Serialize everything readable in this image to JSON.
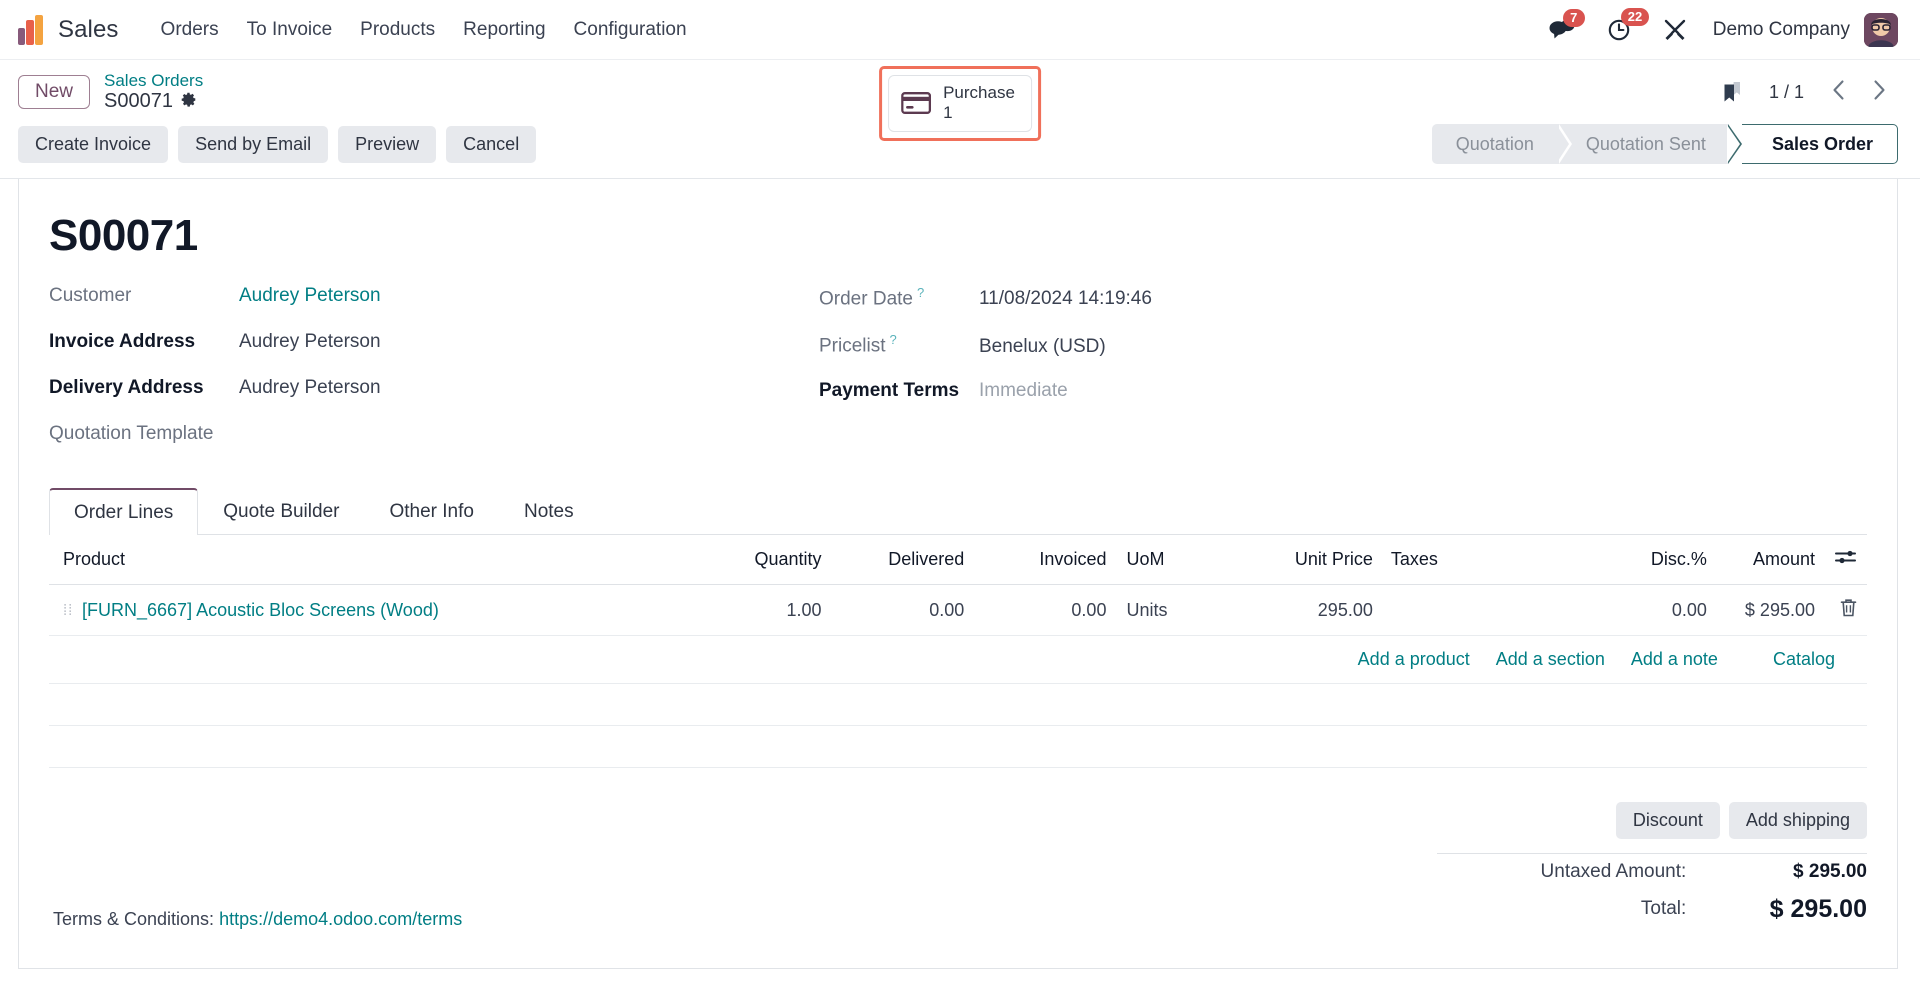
{
  "navbar": {
    "brand": "Sales",
    "menu": [
      "Orders",
      "To Invoice",
      "Products",
      "Reporting",
      "Configuration"
    ],
    "messages_icon": "chat-bubbles-icon",
    "messages_count": "7",
    "activities_icon": "clock-icon",
    "activities_count": "22",
    "debug_icon": "tools-icon",
    "company": "Demo Company",
    "avatar_icon": "user-avatar-icon"
  },
  "control_panel": {
    "new_button": "New",
    "breadcrumb_parent": "Sales Orders",
    "breadcrumb_current": "S00071",
    "settings_icon": "gear-icon",
    "stat_button": {
      "icon": "credit-card-icon",
      "label": "Purchase",
      "value": "1",
      "highlight_color": "#f0705a"
    },
    "bookmark_icon": "bookmark-icon",
    "pager": "1 / 1",
    "prev_icon": "chevron-left-icon",
    "next_icon": "chevron-right-icon",
    "actions": [
      "Create Invoice",
      "Send by Email",
      "Preview",
      "Cancel"
    ],
    "statusbar": {
      "stages": [
        "Quotation",
        "Quotation Sent",
        "Sales Order"
      ],
      "active": "Sales Order",
      "active_border_color": "#3d6b6e"
    }
  },
  "record": {
    "title": "S00071",
    "left_fields": [
      {
        "label": "Customer",
        "value": "Audrey Peterson",
        "label_style": "muted",
        "value_style": "link"
      },
      {
        "label": "Invoice Address",
        "value": "Audrey Peterson",
        "label_style": "bold",
        "value_style": "text"
      },
      {
        "label": "Delivery Address",
        "value": "Audrey Peterson",
        "label_style": "bold",
        "value_style": "text"
      },
      {
        "label": "Quotation Template",
        "value": "",
        "label_style": "muted",
        "value_style": "text"
      }
    ],
    "right_fields": [
      {
        "label": "Order Date",
        "help": "?",
        "value": "11/08/2024 14:19:46",
        "label_style": "muted",
        "value_style": "text"
      },
      {
        "label": "Pricelist",
        "help": "?",
        "value": "Benelux (USD)",
        "label_style": "muted",
        "value_style": "text"
      },
      {
        "label": "Payment Terms",
        "help": "",
        "value": "Immediate",
        "label_style": "bold",
        "value_style": "placeholder"
      }
    ]
  },
  "notebook": {
    "tabs": [
      "Order Lines",
      "Quote Builder",
      "Other Info",
      "Notes"
    ],
    "active_tab": "Order Lines",
    "options_icon": "column-options-icon",
    "columns": [
      "Product",
      "Quantity",
      "Delivered",
      "Invoiced",
      "UoM",
      "Unit Price",
      "Taxes",
      "Disc.%",
      "Amount"
    ],
    "rows": [
      {
        "drag_icon": "drag-handle-icon",
        "product": "[FURN_6667] Acoustic Bloc Screens (Wood)",
        "quantity": "1.00",
        "delivered": "0.00",
        "invoiced": "0.00",
        "uom": "Units",
        "unit_price": "295.00",
        "taxes": "",
        "discount": "0.00",
        "amount": "$ 295.00",
        "delete_icon": "trash-icon"
      }
    ],
    "add_links": [
      "Add a product",
      "Add a section",
      "Add a note",
      "Catalog"
    ]
  },
  "footer": {
    "terms_label": "Terms & Conditions:",
    "terms_url": "https://demo4.odoo.com/terms",
    "buttons": [
      "Discount",
      "Add shipping"
    ],
    "totals": [
      {
        "label": "Untaxed Amount:",
        "value": "$ 295.00"
      },
      {
        "label": "Total:",
        "value": "$ 295.00"
      }
    ]
  }
}
